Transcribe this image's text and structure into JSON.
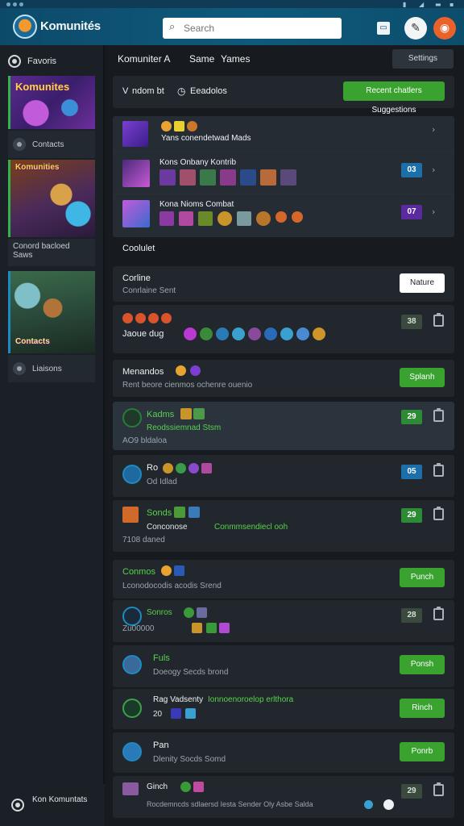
{
  "header": {
    "app_name": "Komunités",
    "search_placeholder": "Search",
    "icons": [
      "logo-icon",
      "search-icon",
      "window-icon",
      "compass-icon",
      "notification-icon"
    ]
  },
  "sidebar": {
    "top_label": "Favoris",
    "game1": {
      "art_title": "Komunites",
      "caption": "Contacts"
    },
    "game2": {
      "art_title": "Komunities",
      "caption": "Conord bacloed Saws"
    },
    "game3": {
      "art_title": "Contacts",
      "caption": "Liaisons"
    },
    "footer_label": "Kon Komuntats"
  },
  "main": {
    "tabs": [
      "Komuniter A",
      "Same",
      "Yames"
    ],
    "tab_button": "Settings",
    "banner": {
      "prefix": "V",
      "text": "ndom bt",
      "text2": "Eeadolos",
      "button": "Recent chatlers Suggestions"
    },
    "cards": [
      {
        "line1": "Yans conendetwad Mads",
        "badge": ""
      },
      {
        "line1": "Kons Onbany Kontrib",
        "badge": "03"
      },
      {
        "line1": "Kona Nioms Combat",
        "badge": "07"
      }
    ],
    "section1": "Coolulet",
    "online": {
      "title": "Corline",
      "subtitle": "Conrlaine Sent",
      "button": "Nature"
    },
    "row_a": {
      "text": "Jaoue dug",
      "badge": "38"
    },
    "members": {
      "title": "Menandos",
      "subtitle": "Rent beore cienmos ochenre ouenio",
      "button": "Splanh"
    },
    "rows": [
      {
        "title": "Kadms",
        "sub": "Reodssiemnad Stsm",
        "sub2": "AO9 bldaloa",
        "badge": "29"
      },
      {
        "title": "Ro",
        "sub": "Od Idlad",
        "badge": "05"
      },
      {
        "title": "Sonds",
        "sub": "Conconose",
        "sub2": "7108 daned",
        "tail": "Conmmsendiecl ooh",
        "badge": "29"
      }
    ],
    "commons": {
      "title": "Conmos",
      "subtitle": "Lconodocodis acodis Srend",
      "button": "Punch"
    },
    "rows2": [
      {
        "title": "Sonros",
        "sub": "Zu00000",
        "badge": "28"
      },
      {
        "title": "Fuls",
        "sub": "Doeogy Secds brond",
        "button": "Ponsh"
      },
      {
        "title": "Rag Vadsenty",
        "tail": "Ionnoenoroelop erlthora",
        "sub": "20",
        "button": "Rinch"
      },
      {
        "title": "Pan",
        "sub": "Dlenity Socds Somd",
        "button": "Ponrb"
      },
      {
        "title": "Ginch",
        "sub": "Rocdemncds sdlaersd Iesta Sender Oly Asbe Salda",
        "badge": "29"
      }
    ]
  },
  "colors": {
    "accent_green": "#3aa32f",
    "header_blue": "#0e5a7c",
    "badge_blue": "#1c6fa8",
    "badge_purple": "#5b2a9e",
    "cta_orange": "#e9622a"
  }
}
